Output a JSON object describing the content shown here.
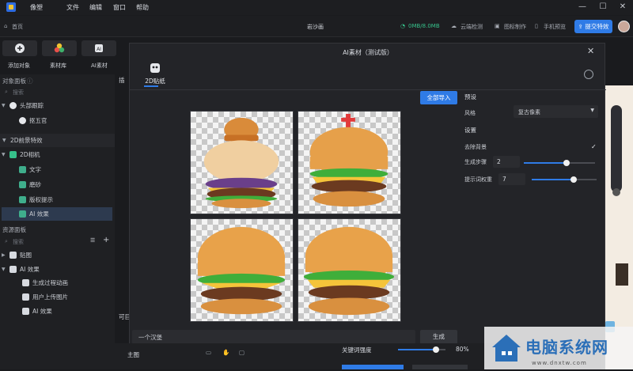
{
  "app": {
    "name": "像塑"
  },
  "menu": [
    "文件",
    "编辑",
    "窗口",
    "帮助"
  ],
  "window_controls": {
    "minimize": "—",
    "maximize": "☐",
    "close": "✕"
  },
  "breadcrumb": "首页",
  "project_title": "岩沙画",
  "toolbar": {
    "storage": "0MB/8.0MB",
    "cloud_check": "云端检测",
    "icon_make": "图标制作",
    "phone_preview": "手机预览",
    "submit": "提交特效"
  },
  "tools": [
    {
      "label": "添加对象",
      "icon": "plus-icon"
    },
    {
      "label": "素材库",
      "icon": "palette-icon"
    },
    {
      "label": "AI素材",
      "icon": "ai-icon"
    }
  ],
  "object_panel": {
    "title": "对象面板",
    "search_placeholder": "搜索",
    "items": [
      {
        "label": "头部跟踪",
        "level": 0,
        "icon": "head-track-icon"
      },
      {
        "label": "抠五官",
        "level": 1,
        "icon": "face-icon"
      },
      {
        "label": "2D前景特效",
        "level": 0,
        "icon": "layer-icon"
      },
      {
        "label": "2D相机",
        "level": 0,
        "icon": "camera-icon"
      },
      {
        "label": "文字",
        "level": 1,
        "icon": "image-icon"
      },
      {
        "label": "磨砂",
        "level": 1,
        "icon": "image-icon"
      },
      {
        "label": "版权提示",
        "level": 1,
        "icon": "image-icon"
      },
      {
        "label": "AI 效果",
        "level": 1,
        "icon": "image-icon",
        "selected": true
      }
    ]
  },
  "resource_panel": {
    "title": "资源面板",
    "search_placeholder": "搜索",
    "items": [
      {
        "label": "贴图",
        "level": 0,
        "icon": "folder-icon"
      },
      {
        "label": "AI 效果",
        "level": 0,
        "icon": "folder-icon"
      },
      {
        "label": "生成过程动画",
        "level": 1,
        "icon": "film-icon"
      },
      {
        "label": "用户上传图片",
        "level": 1,
        "icon": "image-icon"
      },
      {
        "label": "AI 效果",
        "level": 1,
        "icon": "image-icon"
      }
    ]
  },
  "modal": {
    "title": "AI素材（测试版）",
    "tab": "2D贴纸",
    "import_all": "全部导入",
    "prompt": "一个汉堡",
    "generate": "生成",
    "preset_head": "预设",
    "style_label": "风格",
    "style_value": "复古像素",
    "settings_head": "设置",
    "remove_bg_label": "去除背景",
    "remove_bg": true,
    "gen_steps_label": "生成步骤",
    "gen_steps": "2",
    "gen_steps_fraction": 0.6,
    "prompt_weight_label": "提示词权重",
    "prompt_weight": "7",
    "prompt_weight_fraction": 0.65
  },
  "bottom": {
    "main_label": "主图",
    "keyword_strength_label": "关键词强度",
    "keyword_strength": "80%",
    "keyword_strength_fraction": 0.8
  },
  "side_labels": {
    "left_hint": "可目",
    "mid_hint": "插"
  },
  "watermark": {
    "text": "电脑系统网",
    "url": "www.dnxtw.com"
  },
  "colors": {
    "accent": "#2f7be6",
    "bg": "#1a1b1e",
    "panel": "#232428"
  }
}
